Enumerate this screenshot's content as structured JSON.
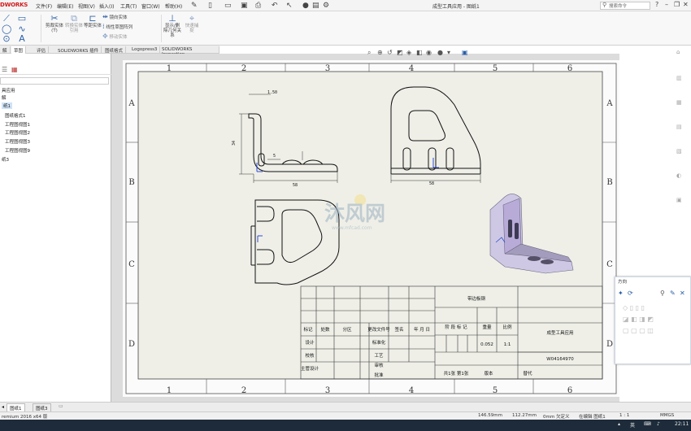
{
  "app": {
    "logo": "DWORKS",
    "doc_title": "成型工具应用 - 图纸1"
  },
  "menu": [
    "文件(F)",
    "编辑(E)",
    "视图(V)",
    "插入(I)",
    "工具(T)",
    "窗口(W)",
    "帮助(H)"
  ],
  "search": {
    "placeholder": "搜索命令"
  },
  "ribbon": {
    "buttons": [
      {
        "label": "剪裁实体(T)",
        "icon": "trim-icon"
      },
      {
        "label": "转换实体引用",
        "icon": "convert-icon"
      },
      {
        "label": "等距实体",
        "icon": "offset-icon"
      },
      {
        "label": "镜向实体",
        "icon": "mirror-icon"
      },
      {
        "label": "线性草图阵列",
        "icon": "pattern-icon"
      },
      {
        "label": "移动实体",
        "icon": "move-icon"
      },
      {
        "label": "显示/删除几何关系",
        "icon": "relations-icon"
      },
      {
        "label": "快速捕捉",
        "icon": "snap-icon"
      }
    ]
  },
  "tabs": [
    "解",
    "草图",
    "评估",
    "SOLIDWORKS 插件",
    "图纸格式",
    "Logopress3",
    "SOLIDWORKS Inspection"
  ],
  "tree": {
    "items": [
      "具应用",
      "解",
      "纸1",
      "图纸格式1",
      "工程图视图1",
      "工程图视图2",
      "工程图视图3",
      "工程图视图9",
      "纸3"
    ]
  },
  "drawing": {
    "col_labels": [
      "1",
      "2",
      "3",
      "4",
      "5",
      "6"
    ],
    "row_labels": [
      "A",
      "B",
      "C",
      "D"
    ],
    "dims": {
      "d1": "1.50",
      "d2": "58",
      "d3": "58",
      "d4": "5",
      "d5": "34"
    },
    "title_block": {
      "part_name": "带边板钢",
      "headers": [
        "标记",
        "处数",
        "分区",
        "更改文件号",
        "签名",
        "年 月 日"
      ],
      "rows": [
        "设计",
        "校核",
        "主管设计"
      ],
      "std": [
        "标准化",
        "工艺",
        "审核",
        "批准"
      ],
      "stage": "阶 段 标 记",
      "weight": "重量",
      "scale": "比例",
      "weight_val": "0.052",
      "scale_val": "1:1",
      "company": "成型工具应用",
      "code": "W04164970",
      "sheet": "共1张  第1张",
      "version": "版本",
      "replace": "替代"
    },
    "watermark": {
      "text": "沐风网",
      "url": "www.mfcad.com"
    }
  },
  "props": {
    "title": "方向"
  },
  "bottom_tabs": [
    "图纸1",
    "图纸3"
  ],
  "status": {
    "left": "remium 2016 x64 版",
    "x": "146.59mm",
    "y": "112.27mm",
    "z": "0mm 欠定义",
    "edit": "在编辑 图纸1",
    "scale": "1 : 1",
    "units": "MMGS"
  },
  "taskbar": {
    "lang": "英",
    "time": "22:11"
  }
}
